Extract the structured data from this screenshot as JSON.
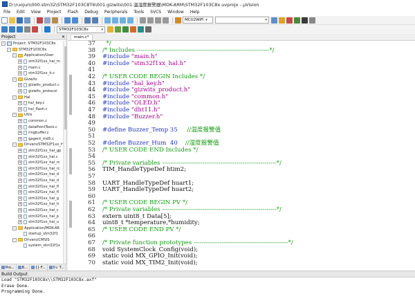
{
  "window": {
    "title": "D:\\ruojun\\000.stm32\\STM32F103C8T6\\001.gizwits\\001.温湿度报警器\\MDK-ARM\\STM32F103C8x.uvprojx - µVision"
  },
  "menu": [
    "File",
    "Edit",
    "View",
    "Project",
    "Flash",
    "Debug",
    "Peripherals",
    "Tools",
    "SVCS",
    "Window",
    "Help"
  ],
  "toolbar": {
    "target_combo": "STM32F103C8x",
    "device_combo": "MCU2WiFi",
    "search_combo": ""
  },
  "project_pane": {
    "title": "Project",
    "tree": [
      {
        "indent": 0,
        "expander": "-",
        "icon": "proj",
        "label": "Project: STM32F103C8x"
      },
      {
        "indent": 1,
        "expander": "-",
        "icon": "folder",
        "label": "STM32F103C8x"
      },
      {
        "indent": 2,
        "expander": "-",
        "icon": "folder",
        "label": "Application/User"
      },
      {
        "indent": 3,
        "expander": "+",
        "icon": "doc",
        "label": "stm32f1xx_hal_m"
      },
      {
        "indent": 3,
        "expander": "+",
        "icon": "doc",
        "label": "main.c"
      },
      {
        "indent": 3,
        "expander": "+",
        "icon": "doc",
        "label": "stm32f1xx_it.c"
      },
      {
        "indent": 2,
        "expander": "-",
        "icon": "folder",
        "label": "Gizwits"
      },
      {
        "indent": 3,
        "expander": "+",
        "icon": "doc",
        "label": "gizwits_product.c"
      },
      {
        "indent": 3,
        "expander": "+",
        "icon": "doc",
        "label": "gizwits_protocol"
      },
      {
        "indent": 2,
        "expander": "-",
        "icon": "folder",
        "label": "Hal"
      },
      {
        "indent": 3,
        "expander": "+",
        "icon": "doc",
        "label": "hal_key.c"
      },
      {
        "indent": 3,
        "expander": "+",
        "icon": "doc",
        "label": "hal_flash.c"
      },
      {
        "indent": 2,
        "expander": "-",
        "icon": "folder",
        "label": "Utils"
      },
      {
        "indent": 3,
        "expander": "+",
        "icon": "doc",
        "label": "common.c"
      },
      {
        "indent": 3,
        "expander": "+",
        "icon": "doc",
        "label": "dataPointTools.c"
      },
      {
        "indent": 3,
        "expander": "+",
        "icon": "doc",
        "label": "ringbuffer.c"
      },
      {
        "indent": 3,
        "expander": "+",
        "icon": "doc",
        "label": "gagent_md5.c"
      },
      {
        "indent": 2,
        "expander": "-",
        "icon": "folder",
        "label": "Drivers/STM32F1xx_H"
      },
      {
        "indent": 3,
        "expander": "+",
        "icon": "doc",
        "label": "stm32f1xx_hal_gp"
      },
      {
        "indent": 3,
        "expander": "+",
        "icon": "doc",
        "label": "stm32f1xx_hal.c"
      },
      {
        "indent": 3,
        "expander": "+",
        "icon": "doc",
        "label": "stm32f1xx_hal_rc"
      },
      {
        "indent": 3,
        "expander": "+",
        "icon": "doc",
        "label": "stm32f1xx_hal_rc"
      },
      {
        "indent": 3,
        "expander": "+",
        "icon": "doc",
        "label": "stm32f1xx_hal_d"
      },
      {
        "indent": 3,
        "expander": "+",
        "icon": "doc",
        "label": "stm32f1xx_hal_d"
      },
      {
        "indent": 3,
        "expander": "+",
        "icon": "doc",
        "label": "stm32f1xx_hal_fl"
      },
      {
        "indent": 3,
        "expander": "+",
        "icon": "doc",
        "label": "stm32f1xx_hal_fl"
      },
      {
        "indent": 3,
        "expander": "+",
        "icon": "doc",
        "label": "stm32f1xx_hal_g"
      },
      {
        "indent": 3,
        "expander": "+",
        "icon": "doc",
        "label": "stm32f1xx_hal_ti"
      },
      {
        "indent": 3,
        "expander": "+",
        "icon": "doc",
        "label": "stm32f1xx_hal_c"
      },
      {
        "indent": 3,
        "expander": "+",
        "icon": "doc",
        "label": "stm32f1xx_hal_p"
      },
      {
        "indent": 3,
        "expander": "+",
        "icon": "doc",
        "label": "stm32f1xx_hal_u"
      },
      {
        "indent": 2,
        "expander": "-",
        "icon": "folder",
        "label": "Application/MDK-AR"
      },
      {
        "indent": 3,
        "expander": "",
        "icon": "doc",
        "label": "startup_stm32f1"
      },
      {
        "indent": 2,
        "expander": "-",
        "icon": "folder",
        "label": "Drivers/CMSIS"
      },
      {
        "indent": 3,
        "expander": "",
        "icon": "doc",
        "label": "system_stm32f1x"
      }
    ],
    "tabs": [
      "Pro...",
      "B...",
      "{} F...",
      "0↓ T..."
    ]
  },
  "editor": {
    "tab_label": "main.c*",
    "lines": [
      {
        "n": "37",
        "kind": "comment",
        "text": "  */"
      },
      {
        "n": "38",
        "kind": "comment",
        "text": "/* Includes ------------------------------------------------------------------*/"
      },
      {
        "n": "39",
        "kind": "include",
        "pre": "#include ",
        "str": "\"main.h\""
      },
      {
        "n": "40",
        "kind": "include",
        "pre": "#include ",
        "str": "\"stm32f1xx_hal.h\""
      },
      {
        "n": "41",
        "kind": "blank",
        "text": ""
      },
      {
        "n": "42",
        "kind": "comment",
        "text": "/* USER CODE BEGIN Includes */"
      },
      {
        "n": "43",
        "kind": "include",
        "pre": "#include ",
        "str": "\"hal_key.h\""
      },
      {
        "n": "44",
        "kind": "include",
        "pre": "#include ",
        "str": "\"gizwits_product.h\""
      },
      {
        "n": "45",
        "kind": "include",
        "pre": "#include ",
        "str": "\"common.h\""
      },
      {
        "n": "46",
        "kind": "include",
        "pre": "#include ",
        "str": "\"OLED.h\""
      },
      {
        "n": "47",
        "kind": "include",
        "pre": "#include ",
        "str": "\"dht11.h\""
      },
      {
        "n": "48",
        "kind": "include",
        "pre": "#include ",
        "str": "\"Buzzer.h\""
      },
      {
        "n": "49",
        "kind": "blank",
        "text": ""
      },
      {
        "n": "50",
        "kind": "define",
        "pre": "#define Buzzer_Temp 35",
        "cm": "     //温度报警值"
      },
      {
        "n": "51",
        "kind": "blank",
        "text": ""
      },
      {
        "n": "52",
        "kind": "define",
        "pre": "#define Buzzer_Hum  40",
        "cm": "    //湿度报警值"
      },
      {
        "n": "53",
        "kind": "comment",
        "text": "/* USER CODE END Includes */"
      },
      {
        "n": "54",
        "kind": "blank",
        "text": ""
      },
      {
        "n": "55",
        "kind": "comment",
        "text": "/* Private variables ---------------------------------------------------------*/"
      },
      {
        "n": "56",
        "kind": "normal",
        "text": "TIM_HandleTypeDef htim2;"
      },
      {
        "n": "57",
        "kind": "blank",
        "text": ""
      },
      {
        "n": "58",
        "kind": "normal",
        "text": "UART_HandleTypeDef huart1;"
      },
      {
        "n": "59",
        "kind": "normal",
        "text": "UART_HandleTypeDef huart2;"
      },
      {
        "n": "60",
        "kind": "blank",
        "text": ""
      },
      {
        "n": "61",
        "kind": "comment",
        "text": "/* USER CODE BEGIN PV */"
      },
      {
        "n": "62",
        "kind": "comment",
        "text": "/* Private variables ---------------------------------------------------------*/"
      },
      {
        "n": "63",
        "kind": "normal",
        "text": "extern uint8_t Data[5];"
      },
      {
        "n": "64",
        "kind": "normal",
        "text": "uint8_t *temperature,*humidity;"
      },
      {
        "n": "65",
        "kind": "comment",
        "text": "/* USER CODE END PV */"
      },
      {
        "n": "66",
        "kind": "blank",
        "text": ""
      },
      {
        "n": "67",
        "kind": "comment",
        "text": "/* Private function prototypes -----------------------------------------------*/"
      },
      {
        "n": "68",
        "kind": "normal",
        "text": "void SystemClock_Config(void);"
      },
      {
        "n": "69",
        "kind": "normal",
        "text": "static void MX_GPIO_Init(void);"
      },
      {
        "n": "70",
        "kind": "normal",
        "text": "static void MX_TIM2_Init(void);"
      }
    ]
  },
  "build_output": {
    "title": "Build Output",
    "lines": [
      "Load \"STM32F103C8x\\\\STM32F103C8x.axf\"",
      "Erase Done.",
      "Programming Done."
    ]
  },
  "colors": {
    "comment": "#119911",
    "preprocessor": "#2233bb",
    "string": "#a0008a"
  }
}
